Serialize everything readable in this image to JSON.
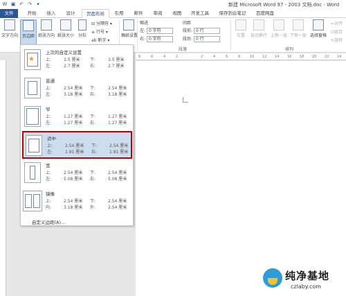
{
  "window": {
    "title": "新建 Microsoft Word 97 - 2003 文档.doc - Word"
  },
  "tabs": [
    "文件",
    "开始",
    "插入",
    "设计",
    "页面布局",
    "引用",
    "邮件",
    "审阅",
    "视图",
    "开发工具",
    "保存到云笔记",
    "百度网盘"
  ],
  "ribbon": {
    "text_direction": "文字方向",
    "margins": "页边距",
    "orientation": "纸张方向",
    "size": "纸张大小",
    "columns": "分栏",
    "breaks": "分隔符",
    "line_numbers": "行号",
    "hyphenation": "断字",
    "paper_setup": "稿纸设置",
    "indent_label": "缩进",
    "spacing_label": "间距",
    "left_label": "左:",
    "right_label": "右:",
    "before_label": "段前:",
    "after_label": "段后:",
    "indent_left_value": "0 字符",
    "indent_right_value": "0 字符",
    "before_value": "0 行",
    "after_value": "0 行",
    "paragraph_group": "段落",
    "position": "位置",
    "wrap": "自动换行",
    "bring_forward": "上移一层",
    "send_backward": "下移一层",
    "selection_pane": "选择窗格",
    "align": "对齐",
    "group": "组合",
    "rotate": "旋转",
    "arrange_group": "排列"
  },
  "ruler_marks": [
    "8",
    "6",
    "4",
    "2",
    "2",
    "4",
    "6",
    "8",
    "10",
    "12",
    "14",
    "16",
    "18",
    "20",
    "22",
    "24"
  ],
  "margins_menu": {
    "options": [
      {
        "name": "上次的自定义设置",
        "top_label": "上:",
        "top": "3.5 厘米",
        "bottom_label": "下:",
        "bottom": "3.5 厘米",
        "left_label": "左:",
        "left": "2.7 厘米",
        "right_label": "右:",
        "right": "2.7 厘米"
      },
      {
        "name": "普通",
        "top_label": "上:",
        "top": "2.54 厘米",
        "bottom_label": "下:",
        "bottom": "2.54 厘米",
        "left_label": "左:",
        "left": "3.18 厘米",
        "right_label": "右:",
        "right": "3.18 厘米"
      },
      {
        "name": "窄",
        "top_label": "上:",
        "top": "1.27 厘米",
        "bottom_label": "下:",
        "bottom": "1.27 厘米",
        "left_label": "左:",
        "left": "1.27 厘米",
        "right_label": "右:",
        "right": "1.27 厘米"
      },
      {
        "name": "适中",
        "top_label": "上:",
        "top": "2.54 厘米",
        "bottom_label": "下:",
        "bottom": "2.54 厘米",
        "left_label": "左:",
        "left": "1.91 厘米",
        "right_label": "右:",
        "right": "1.91 厘米"
      },
      {
        "name": "宽",
        "top_label": "上:",
        "top": "2.54 厘米",
        "bottom_label": "下:",
        "bottom": "2.54 厘米",
        "left_label": "左:",
        "left": "5.08 厘米",
        "right_label": "右:",
        "right": "5.08 厘米"
      },
      {
        "name": "镜像",
        "top_label": "上:",
        "top": "2.54 厘米",
        "bottom_label": "下:",
        "bottom": "2.54 厘米",
        "left_label": "内:",
        "left": "3.18 厘米",
        "right_label": "外:",
        "right": "2.54 厘米"
      }
    ],
    "custom": "自定义边距(A)..."
  },
  "watermark": {
    "brand": "纯净基地",
    "url": "czlaby.com"
  },
  "colors": {
    "accent": "#2b579a",
    "selection": "#cddcee",
    "highlight_border": "#c00000"
  }
}
